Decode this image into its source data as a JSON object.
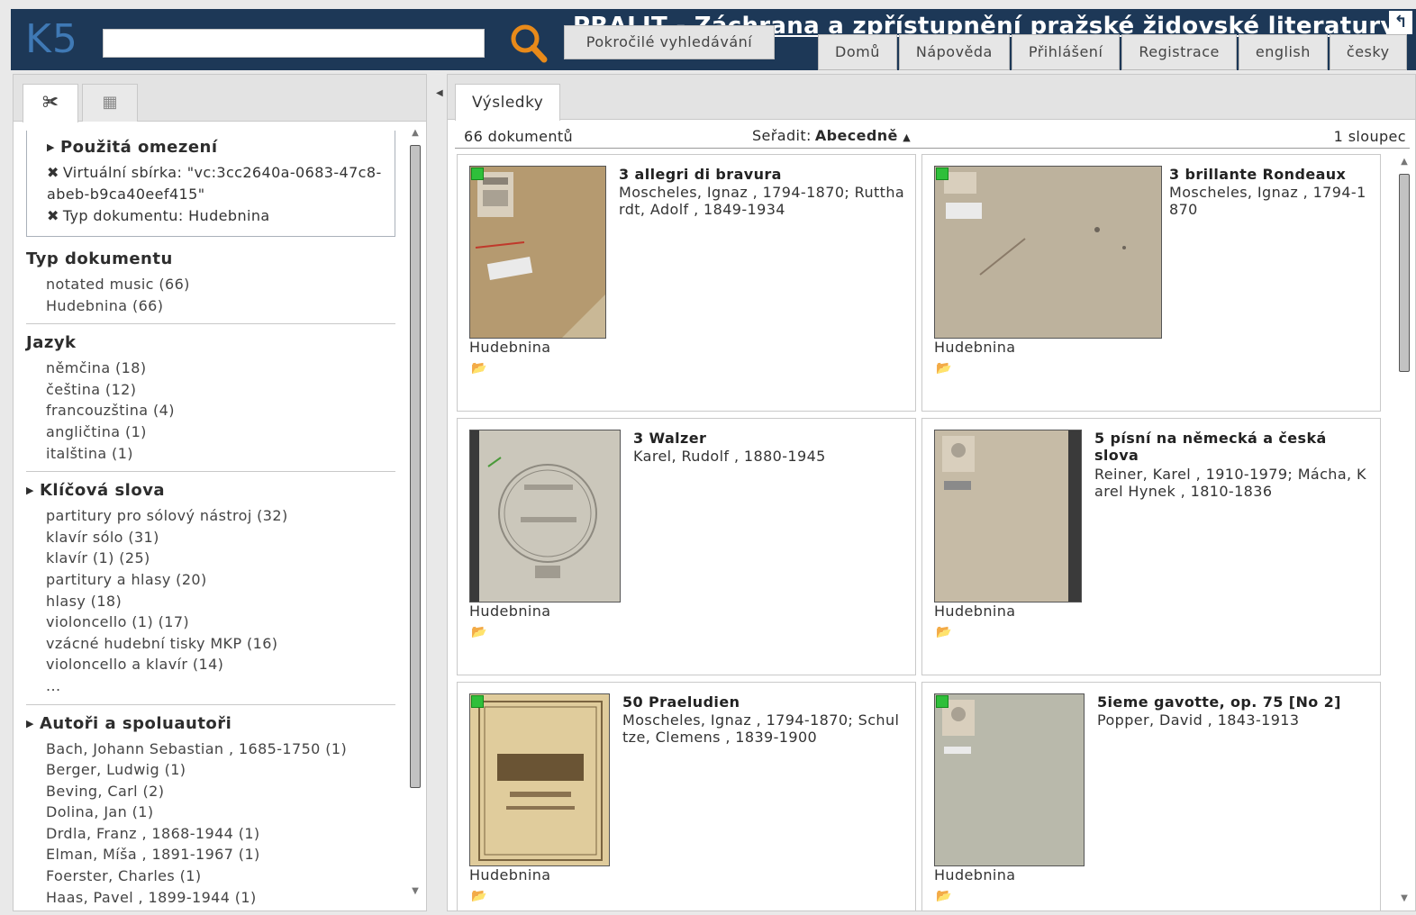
{
  "header": {
    "logo": "K5",
    "search_value": "",
    "advanced_search": "Pokročilé vyhledávání",
    "site_title": "PRALIT - Záchrana a zpřístupnění pražské židovské literatury",
    "nav": [
      "Domů",
      "Nápověda",
      "Přihlášení",
      "Registrace",
      "english",
      "česky"
    ],
    "back_icon": "↰"
  },
  "left": {
    "tabs": [
      {
        "icon": "scissors-icon",
        "glyph": "✀"
      },
      {
        "icon": "calendar-icon",
        "glyph": "▦"
      }
    ],
    "applied": {
      "title": "Použitá omezení",
      "items": [
        "Virtuální sbírka: \"vc:3cc2640a-0683-47c8-abeb-b9ca40eef415\"",
        "Typ dokumentu: Hudebnina"
      ]
    },
    "facets": [
      {
        "title": "Typ dokumentu",
        "collapsible": false,
        "items": [
          "notated music (66)",
          "Hudebnina (66)"
        ]
      },
      {
        "title": "Jazyk",
        "collapsible": false,
        "items": [
          "němčina (18)",
          "čeština (12)",
          "francouzština (4)",
          "angličtina (1)",
          "italština (1)"
        ]
      },
      {
        "title": "Klíčová slova",
        "collapsible": true,
        "items": [
          "partitury pro sólový nástroj (32)",
          "klavír sólo (31)",
          "klavír (1) (25)",
          "partitury a hlasy (20)",
          "hlasy (18)",
          "violoncello (1) (17)",
          "vzácné hudební tisky MKP (16)",
          "violoncello a klavír (14)",
          "..."
        ]
      },
      {
        "title": "Autoři a spoluautoři",
        "collapsible": true,
        "items": [
          "Bach, Johann Sebastian , 1685-1750 (1)",
          "Berger, Ludwig (1)",
          "Beving, Carl (2)",
          "Dolina, Jan (1)",
          "Drdla, Franz , 1868-1944 (1)",
          "Elman, Míša , 1891-1967 (1)",
          "Foerster, Charles (1)",
          "Haas, Pavel , 1899-1944 (1)"
        ]
      }
    ]
  },
  "right": {
    "tab": "Výsledky",
    "count": "66 dokumentů",
    "sort_label": "Seřadit:",
    "sort_value": "Abecedně",
    "columns": "1 sloupec",
    "cards": [
      {
        "title": "3 allegri di bravura",
        "author": "Moscheles, Ignaz , 1794-1870; Rutthardt, Adolf , 1849-1934",
        "type": "Hudebnina"
      },
      {
        "title": "3 brillante Rondeaux",
        "author": "Moscheles, Ignaz , 1794-1870",
        "type": "Hudebnina"
      },
      {
        "title": "3 Walzer",
        "author": "Karel, Rudolf , 1880-1945",
        "type": "Hudebnina"
      },
      {
        "title": "5 písní na německá a česká slova",
        "author": "Reiner, Karel , 1910-1979; Mácha, Karel Hynek , 1810-1836",
        "type": "Hudebnina"
      },
      {
        "title": "50 Praeludien",
        "author": "Moscheles, Ignaz , 1794-1870; Schultze, Clemens , 1839-1900",
        "type": "Hudebnina"
      },
      {
        "title": "5ieme gavotte, op. 75 [No 2]",
        "author": "Popper, David , 1843-1913",
        "type": "Hudebnina"
      }
    ]
  },
  "colors": {
    "header": "#1d3857",
    "logo": "#3f79b5",
    "search_icon": "#e88a1a",
    "availability": "#2fbf3a"
  }
}
